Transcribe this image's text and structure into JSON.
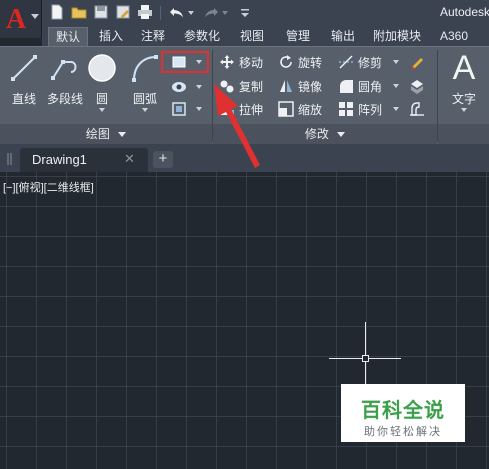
{
  "app": {
    "title": "Autodesk",
    "logo_letter": "A"
  },
  "quick_access": {
    "icons": [
      "new-file-icon",
      "open-folder-icon",
      "save-icon",
      "save-as-icon",
      "print-icon",
      "undo-icon",
      "redo-icon"
    ]
  },
  "tabs": [
    "默认",
    "插入",
    "注释",
    "参数化",
    "视图",
    "管理",
    "输出",
    "附加模块",
    "A360"
  ],
  "active_tab": "默认",
  "draw_panel": {
    "title": "绘图",
    "tools": {
      "line": "直线",
      "polyline": "多段线",
      "circle": "圆",
      "arc": "圆弧"
    }
  },
  "modify_panel": {
    "title": "修改",
    "tools": {
      "move": "移动",
      "rotate": "旋转",
      "trim": "修剪",
      "copy": "复制",
      "mirror": "镜像",
      "fillet": "圆角",
      "stretch": "拉伸",
      "scale": "缩放",
      "array": "阵列"
    }
  },
  "annotation_panel": {
    "text_label": "文字",
    "text_glyph": "A"
  },
  "document": {
    "tab_name": "Drawing1",
    "close_glyph": "✕",
    "new_tab_glyph": "+"
  },
  "viewport": {
    "label": "[−][俯视][二维线框]"
  },
  "watermark": {
    "title": "百科全说",
    "subtitle": "助你轻松解决"
  },
  "colors": {
    "accent_red": "#e03030",
    "logo_red": "#d9281f",
    "watermark_green": "#3aa04a",
    "canvas_bg": "#212830",
    "ribbon_bg": "#575f6b"
  }
}
